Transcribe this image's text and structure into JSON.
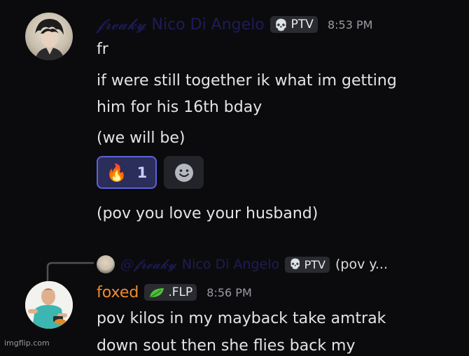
{
  "colors": {
    "background": "#0b0b0d",
    "text": "#e3e4e8",
    "timestamp": "#9a9ca3",
    "name_gradient_dark": "#1d1c5a",
    "reply_author": "#f0892e",
    "reaction_border": "#5a62d8",
    "reaction_bg": "#2b2d5a",
    "reaction_count": "#c9ccff"
  },
  "message1": {
    "author_prefix": "𝓯𝓻𝓮𝓪𝓴𝔂",
    "author_name": "Nico Di Angelo",
    "tag_icon": "skull-icon",
    "tag_text": "PTV",
    "timestamp": "8:53 PM",
    "lines": [
      "fr",
      "if were still together ik what im getting",
      "him for his 16th bday",
      "(we will be)"
    ],
    "reaction": {
      "emoji": "🔥",
      "count": "1"
    },
    "add_reaction_icon": "smiley-icon",
    "followup": "(pov you love your husband)"
  },
  "message2": {
    "reply": {
      "mention_prefix": "@𝓯𝓻𝓮𝓪𝓴𝔂",
      "mention_name": "Nico Di Angelo",
      "tag_text": "PTV",
      "preview": "(pov y..."
    },
    "author_name": "foxed",
    "tag_icon": "leaf-icon",
    "tag_text": ".FLP",
    "timestamp": "8:56 PM",
    "lines": [
      "pov kilos in my mayback take amtrak",
      "down sout then she flies back my"
    ]
  },
  "watermark": "imgflip.com"
}
